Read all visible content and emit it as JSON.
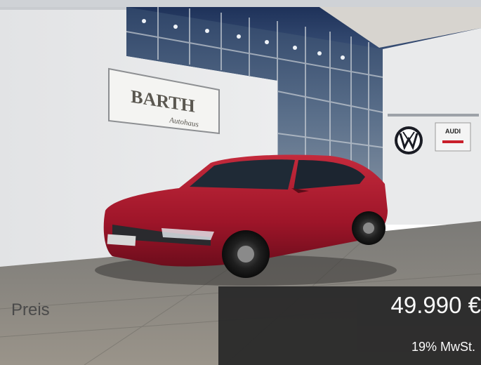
{
  "dealer_sign": {
    "line1": "BARTH",
    "line2": "Autohaus"
  },
  "brand_logo_icon": "vw-logo-icon",
  "audi_sign": "AUDI",
  "price": {
    "label": "Preis",
    "value": "49.990 €",
    "tax_note": "19% MwSt."
  },
  "colors": {
    "price_box": "#2b2b2b",
    "car_body": "#b01c30",
    "wall": "#e8e9ea"
  }
}
